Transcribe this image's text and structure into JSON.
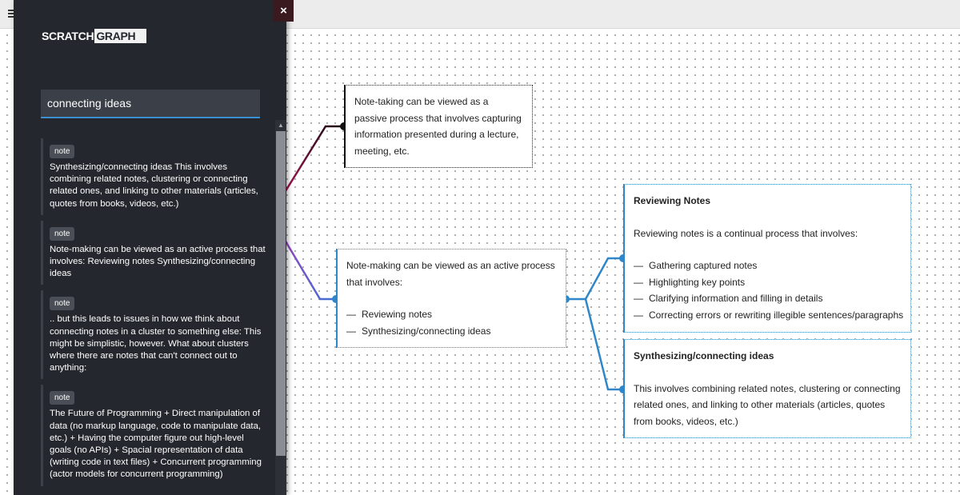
{
  "app": {
    "logo_part1": "SCRATCH",
    "logo_part2": "GRAPH"
  },
  "sidebar": {
    "close_label": "×",
    "search": {
      "value": "connecting ideas"
    },
    "results": [
      {
        "tag": "note",
        "text": "Synthesizing/connecting ideas This involves combining related notes, clustering or connecting related ones, and linking to other materials (articles, quotes from books, videos, etc.)"
      },
      {
        "tag": "note",
        "text": "Note-making can be viewed as an active process that involves: Reviewing notes Synthesizing/connecting ideas"
      },
      {
        "tag": "note",
        "text": ".. but this leads to issues in how we think about connecting notes in a cluster to something else: This might be simplistic, however. What about clusters where there are notes that can't connect out to anything:"
      },
      {
        "tag": "note",
        "text": "The Future of Programming + Direct manipulation of data (no markup language, code to manipulate data, etc.) + Having the computer figure out high-level goals (no APIs) + Spacial representation of data (writing code in text files) + Concurrent programming (actor models for concurrent programming)"
      }
    ]
  },
  "graph": {
    "node_passive": {
      "text": "Note-taking can be viewed as a passive process that involves capturing information presented during a lecture, meeting, etc."
    },
    "node_active": {
      "text": "Note-making can be viewed as an active process that involves:",
      "items": [
        "Reviewing notes",
        "Synthesizing/connecting ideas"
      ]
    },
    "node_reviewing": {
      "title": "Reviewing Notes",
      "text": "Reviewing notes is a continual process that involves:",
      "items": [
        "Gathering captured notes",
        "Highlighting key points",
        "Clarifying information and filling in details",
        "Correcting errors or rewriting illegible sentences/paragraphs"
      ]
    },
    "node_synth": {
      "title": "Synthesizing/connecting ideas",
      "text": "This involves combining related notes, clustering or connecting related ones, and linking to other materials (articles, quotes from books, videos, etc.)"
    }
  },
  "colors": {
    "sidebar_bg": "#24272d",
    "accent_blue": "#2f86c8",
    "search_underline": "#3a8fd0",
    "edge_dark": "#5a0a2a",
    "edge_purple": "#9b3fbf"
  }
}
